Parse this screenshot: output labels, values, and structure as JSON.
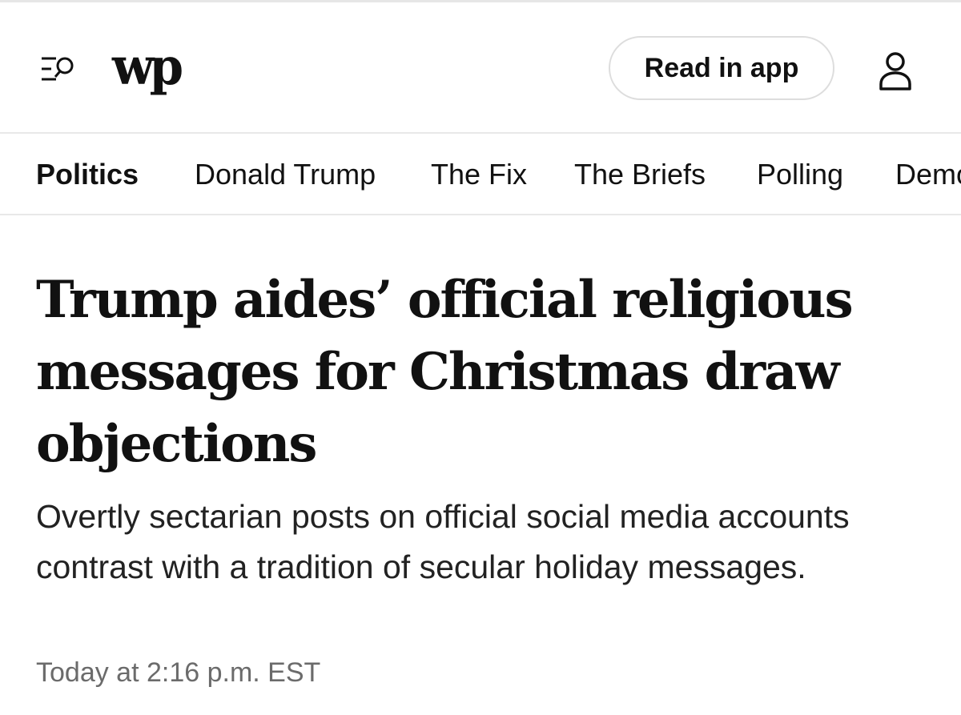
{
  "header": {
    "menu_icon": "menu-search-icon",
    "logo_text": "wp",
    "read_in_app_label": "Read in app",
    "user_icon": "user-icon"
  },
  "section_nav": {
    "items": [
      {
        "label": "Politics",
        "active": true
      },
      {
        "label": "Donald Trump",
        "active": false
      },
      {
        "label": "The Fix",
        "active": false
      },
      {
        "label": "The Briefs",
        "active": false
      },
      {
        "label": "Polling",
        "active": false
      },
      {
        "label": "Democracy Dies in Darkness",
        "active": false
      }
    ]
  },
  "article": {
    "headline": "Trump aides’ official religious messages for Christmas draw objections",
    "subheadline": "Overtly sectarian posts on official social media accounts contrast with a tradition of secular holiday messages.",
    "timestamp": "Today at 2:16 p.m. EST"
  },
  "colors": {
    "text": "#111111",
    "subtext": "#222222",
    "muted": "#6b6b6b",
    "divider": "#e8e8e8",
    "button_border": "#dddddd"
  }
}
